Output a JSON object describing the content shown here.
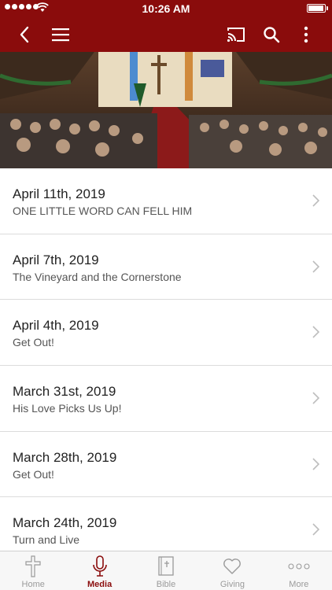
{
  "status_bar": {
    "time": "10:26 AM"
  },
  "nav": {
    "back_icon": "chevron-left-icon",
    "menu_icon": "hamburger-menu-icon",
    "cast_icon": "cast-icon",
    "search_icon": "search-icon",
    "more_icon": "vertical-ellipsis-icon"
  },
  "colors": {
    "brand": "#8a0c0c",
    "text": "#222222",
    "subtext": "#555555",
    "divider": "#dcdcdc",
    "tab_inactive": "#9a9a9a"
  },
  "sermons": [
    {
      "date": "April 11th, 2019",
      "title": "ONE LITTLE WORD CAN FELL HIM"
    },
    {
      "date": "April 7th, 2019",
      "title": "The Vineyard and the Cornerstone"
    },
    {
      "date": "April 4th, 2019",
      "title": "Get Out!"
    },
    {
      "date": "March 31st, 2019",
      "title": "His Love Picks Us Up!"
    },
    {
      "date": "March 28th, 2019",
      "title": "Get Out!"
    },
    {
      "date": "March 24th, 2019",
      "title": "Turn and Live"
    }
  ],
  "tabbar": {
    "home": "Home",
    "media": "Media",
    "bible": "Bible",
    "giving": "Giving",
    "more": "More",
    "active": "media"
  }
}
